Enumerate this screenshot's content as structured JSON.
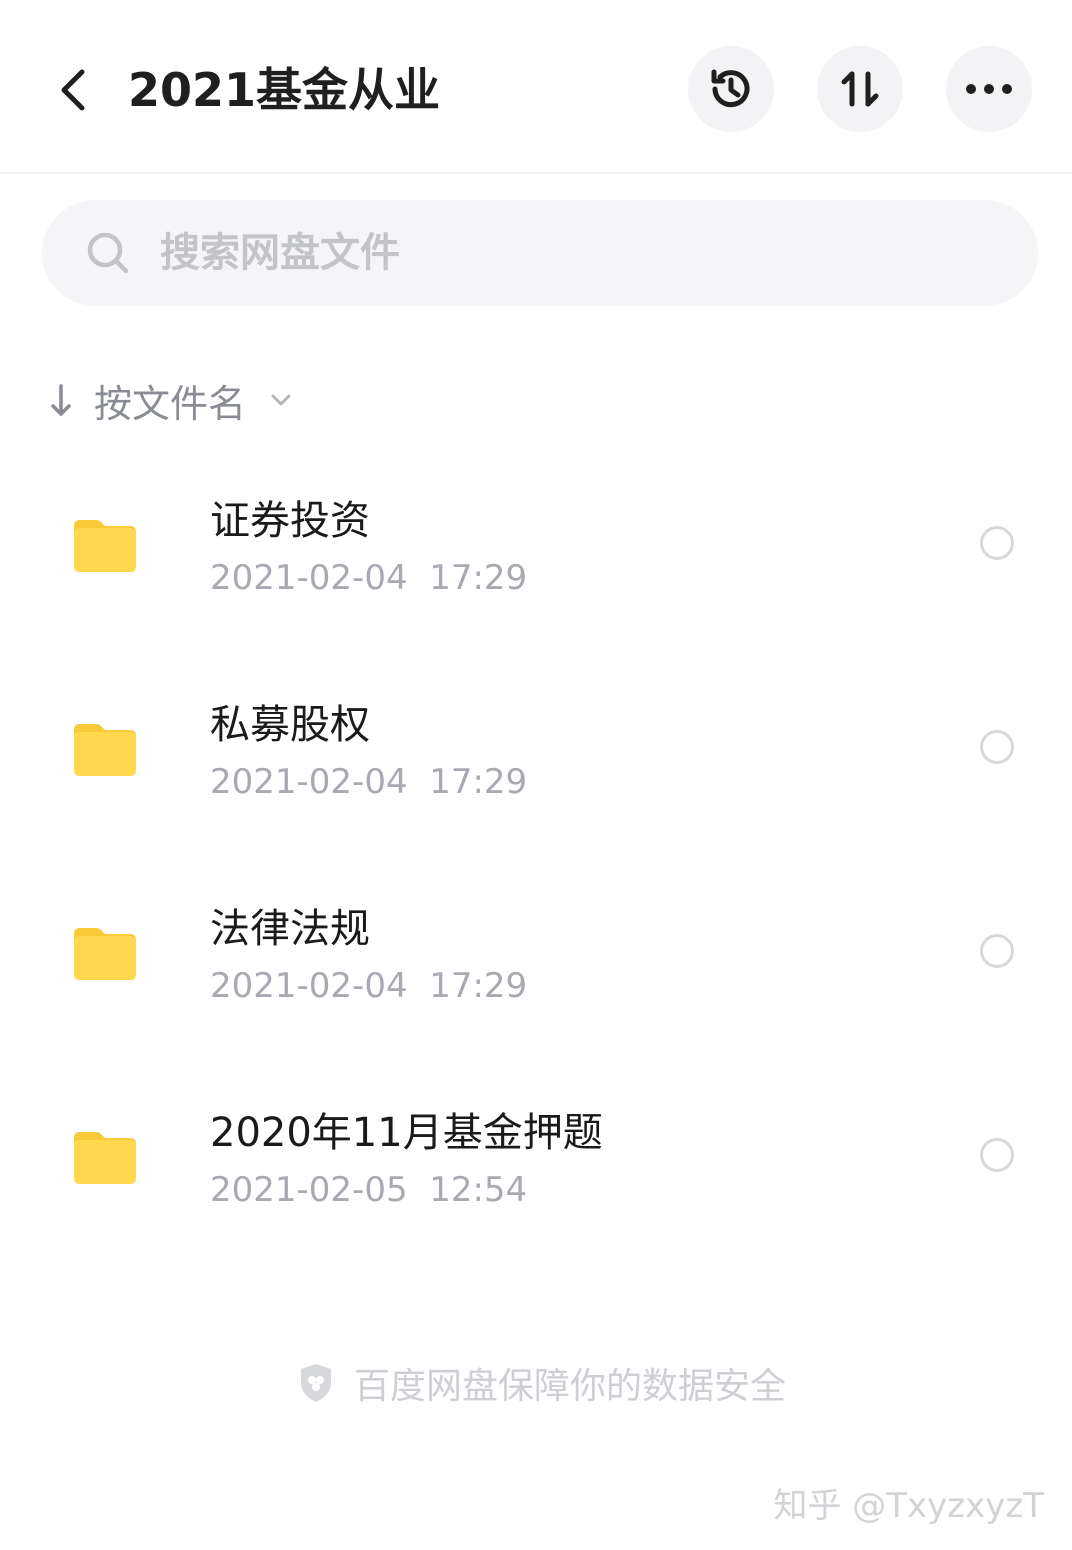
{
  "header": {
    "title": "2021基金从业"
  },
  "search": {
    "placeholder": "搜索网盘文件"
  },
  "sort": {
    "label": "按文件名"
  },
  "files": [
    {
      "name": "证券投资",
      "modified": "2021-02-04  17:29"
    },
    {
      "name": "私募股权",
      "modified": "2021-02-04  17:29"
    },
    {
      "name": "法律法规",
      "modified": "2021-02-04  17:29"
    },
    {
      "name": "2020年11月基金押题",
      "modified": "2021-02-05  12:54"
    }
  ],
  "footer": {
    "security_notice": "百度网盘保障你的数据安全"
  },
  "watermark": "知乎 @TxyzxyzT",
  "colors": {
    "folder": "#FFD84D",
    "folder_tab": "#F9C93A",
    "title_text": "#1F1F1F",
    "secondary_text": "#A8AAB1",
    "button_bg": "#F3F3F5"
  },
  "icons": {
    "back": "chevron-left-icon",
    "history": "history-icon",
    "sort": "sort-arrows-icon",
    "more": "more-horizontal-icon",
    "search": "search-icon",
    "sort_direction": "arrow-down-icon",
    "dropdown": "chevron-down-icon",
    "folder": "folder-icon",
    "shield": "shield-icon"
  }
}
